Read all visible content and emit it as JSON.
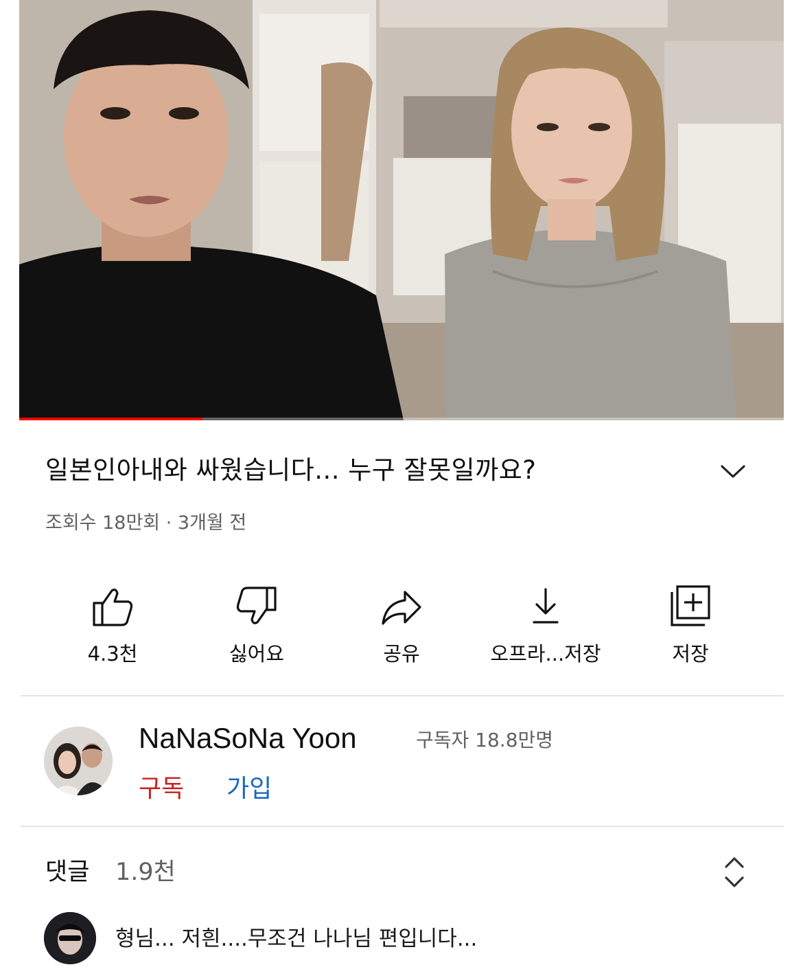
{
  "video": {
    "progress_fraction": 0.24,
    "title": "일본인아내와 싸웠습니다... 누구 잘못일까요?",
    "meta": "조회수 18만회 · 3개월 전"
  },
  "actions": [
    {
      "icon": "thumbs-up-icon",
      "label": "4.3천"
    },
    {
      "icon": "thumbs-down-icon",
      "label": "싫어요"
    },
    {
      "icon": "share-icon",
      "label": "공유"
    },
    {
      "icon": "download-icon",
      "label": "오프라...저장"
    },
    {
      "icon": "save-to-playlist-icon",
      "label": "저장"
    }
  ],
  "channel": {
    "name": "NaNaSoNa Yoon",
    "subscribers": "구독자 18.8만명",
    "subscribe_label": "구독",
    "join_label": "가입"
  },
  "comments": {
    "label": "댓글",
    "count": "1.9천",
    "first_comment": "형님... 저흰....무조건 나나님 편입니다..."
  },
  "colors": {
    "subscribe": "#cc1f1f",
    "join": "#1a66c7",
    "progress": "#ff0000"
  }
}
